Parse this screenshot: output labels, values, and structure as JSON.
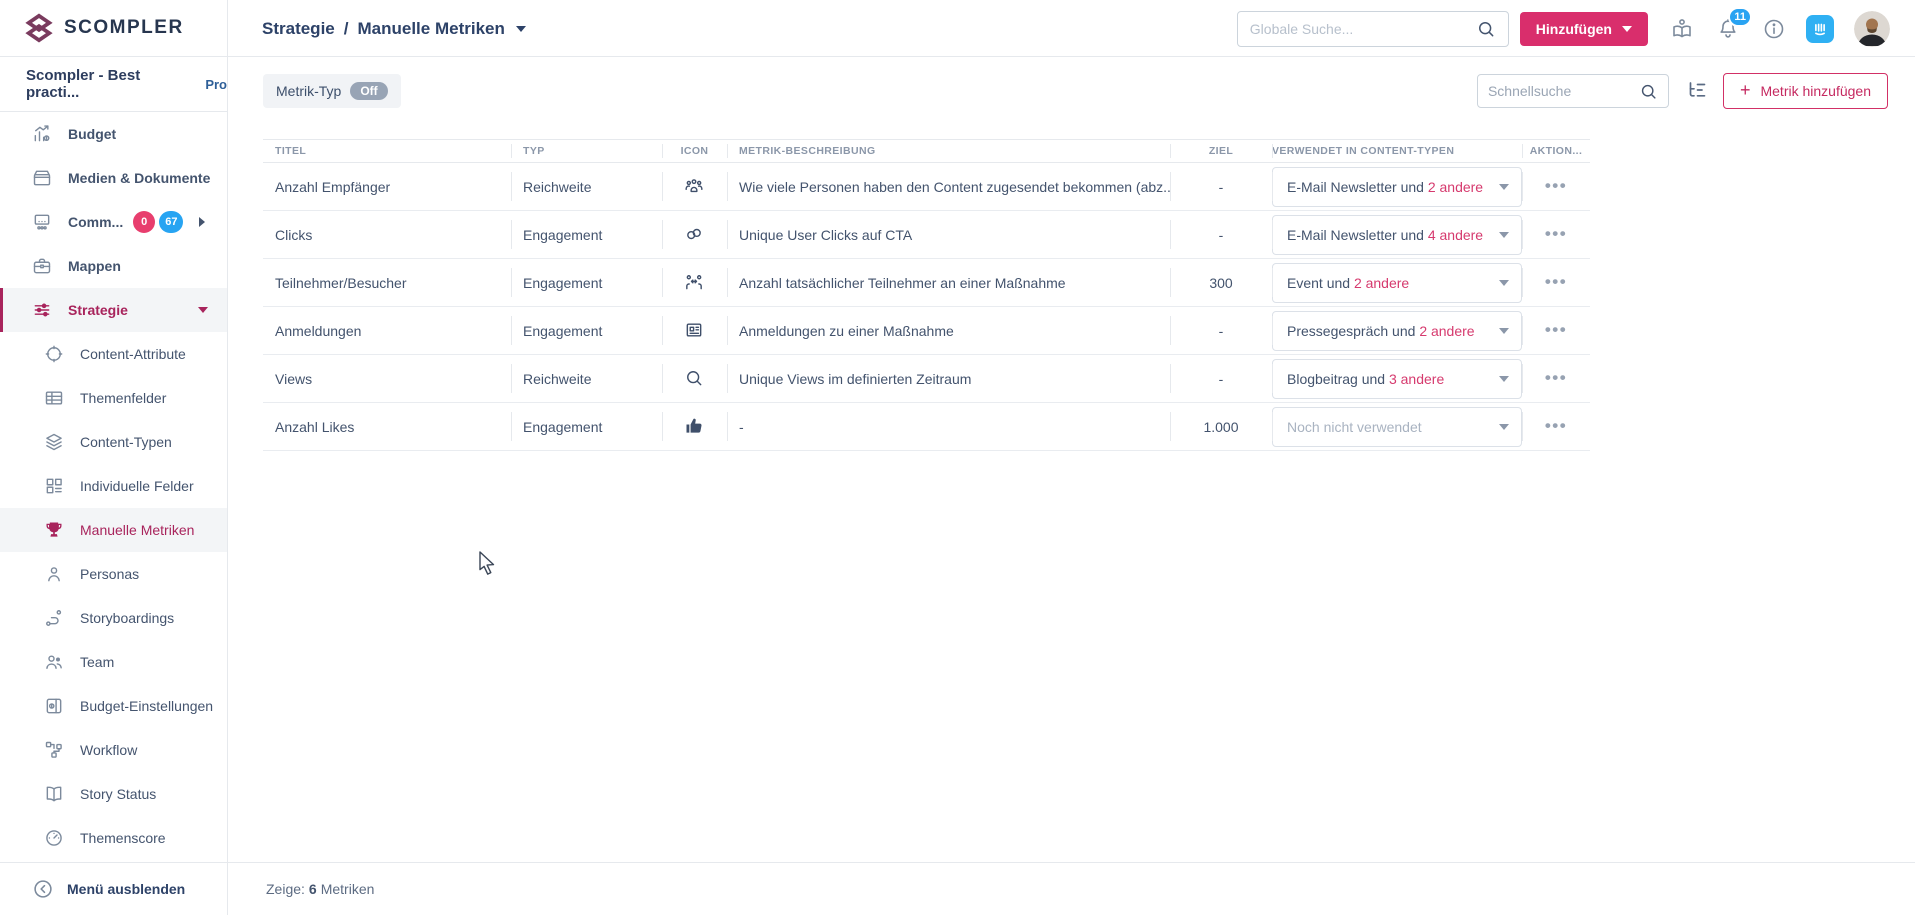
{
  "brand": {
    "name": "SCOMPLER"
  },
  "workspace": {
    "name": "Scompler - Best practi...",
    "badge": "Pro"
  },
  "colors": {
    "accent_pink": "#d92e6c",
    "sidebar_active": "#a8245c",
    "badge_pink": "#e83e6e",
    "badge_blue": "#27a4f2",
    "notification_blue": "#29a3f2",
    "intercom_blue": "#2fb0f3",
    "off_pill_gray": "#98a4b5"
  },
  "sidebar": {
    "items": [
      {
        "id": "budget",
        "label": "Budget",
        "icon": "chart-growth-icon",
        "level": 1
      },
      {
        "id": "medien-dokumente",
        "label": "Medien & Dokumente",
        "icon": "archive-box-icon",
        "level": 1
      },
      {
        "id": "community",
        "label": "Comm...",
        "icon": "audience-icon",
        "level": 1,
        "badges": [
          {
            "text": "0",
            "color": "#e83e6e"
          },
          {
            "text": "67",
            "color": "#27a4f2"
          }
        ],
        "trailing": "caret-right"
      },
      {
        "id": "mappen",
        "label": "Mappen",
        "icon": "briefcase-icon",
        "level": 1
      },
      {
        "id": "strategie",
        "label": "Strategie",
        "icon": "sliders-icon",
        "level": 1,
        "active": "parent",
        "trailing": "caret-down"
      },
      {
        "id": "content-attribute",
        "label": "Content-Attribute",
        "icon": "target-icon",
        "level": 2
      },
      {
        "id": "themenfelder",
        "label": "Themenfelder",
        "icon": "table-icon",
        "level": 2
      },
      {
        "id": "content-typen",
        "label": "Content-Typen",
        "icon": "layers-icon",
        "level": 2
      },
      {
        "id": "individuelle-felder",
        "label": "Individuelle Felder",
        "icon": "grid-icon",
        "level": 2
      },
      {
        "id": "manuelle-metriken",
        "label": "Manuelle Metriken",
        "icon": "trophy-icon",
        "level": 2,
        "active": "sub"
      },
      {
        "id": "personas",
        "label": "Personas",
        "icon": "person-icon",
        "level": 2
      },
      {
        "id": "storyboardings",
        "label": "Storyboardings",
        "icon": "route-icon",
        "level": 2
      },
      {
        "id": "team",
        "label": "Team",
        "icon": "team-icon",
        "level": 2
      },
      {
        "id": "budget-einstellungen",
        "label": "Budget-Einstellungen",
        "icon": "money-doc-icon",
        "level": 2
      },
      {
        "id": "workflow",
        "label": "Workflow",
        "icon": "workflow-icon",
        "level": 2
      },
      {
        "id": "story-status",
        "label": "Story Status",
        "icon": "book-icon",
        "level": 2
      },
      {
        "id": "themenscore",
        "label": "Themenscore",
        "icon": "gauge-icon",
        "level": 2
      }
    ],
    "collapse_label": "Menü ausblenden"
  },
  "topbar": {
    "breadcrumb_parent": "Strategie",
    "breadcrumb_separator": "/",
    "breadcrumb_current": "Manuelle Metriken",
    "search_placeholder": "Globale Suche...",
    "add_label": "Hinzufügen",
    "notification_count": "11"
  },
  "filterbar": {
    "filter_label": "Metrik-Typ",
    "filter_state": "Off",
    "quicksearch_placeholder": "Schnellsuche",
    "add_metric_label": "Metrik hinzufügen",
    "add_metric_plus": "+"
  },
  "table": {
    "columns": [
      {
        "id": "titel",
        "label": "TITEL"
      },
      {
        "id": "typ",
        "label": "TYP"
      },
      {
        "id": "icon",
        "label": "ICON"
      },
      {
        "id": "desc",
        "label": "METRIK-BESCHREIBUNG"
      },
      {
        "id": "ziel",
        "label": "ZIEL"
      },
      {
        "id": "used",
        "label": "VERWENDET IN CONTENT-TYPEN"
      },
      {
        "id": "aktion",
        "label": "AKTION..."
      }
    ],
    "rows": [
      {
        "title": "Anzahl Empfänger",
        "typ": "Reichweite",
        "icon": "audience-group-icon",
        "description": "Wie viele Personen haben den Content zugesendet bekommen (abz...",
        "ziel": "-",
        "used_prefix": "E-Mail Newsletter und ",
        "used_highlight": "2 andere"
      },
      {
        "title": "Clicks",
        "typ": "Engagement",
        "icon": "link-icon",
        "description": "Unique User Clicks auf CTA",
        "ziel": "-",
        "used_prefix": "E-Mail Newsletter und ",
        "used_highlight": "4 andere"
      },
      {
        "title": "Teilnehmer/Besucher",
        "typ": "Engagement",
        "icon": "people-arrows-icon",
        "description": "Anzahl tatsächlicher Teilnehmer an einer Maßnahme",
        "ziel": "300",
        "used_prefix": "Event und ",
        "used_highlight": "2 andere"
      },
      {
        "title": "Anmeldungen",
        "typ": "Engagement",
        "icon": "newspaper-icon",
        "description": "Anmeldungen zu einer Maßnahme",
        "ziel": "-",
        "used_prefix": "Pressegespräch und ",
        "used_highlight": "2 andere"
      },
      {
        "title": "Views",
        "typ": "Reichweite",
        "icon": "magnifier-icon",
        "description": "Unique Views im definierten Zeitraum",
        "ziel": "-",
        "used_prefix": "Blogbeitrag und ",
        "used_highlight": "3 andere"
      },
      {
        "title": "Anzahl Likes",
        "typ": "Engagement",
        "icon": "thumbs-up-icon",
        "description": "-",
        "ziel": "1.000",
        "used_placeholder": "Noch nicht verwendet"
      }
    ],
    "row_menu": "•••"
  },
  "footer": {
    "label": "Zeige:",
    "count": "6",
    "suffix": "Metriken"
  }
}
